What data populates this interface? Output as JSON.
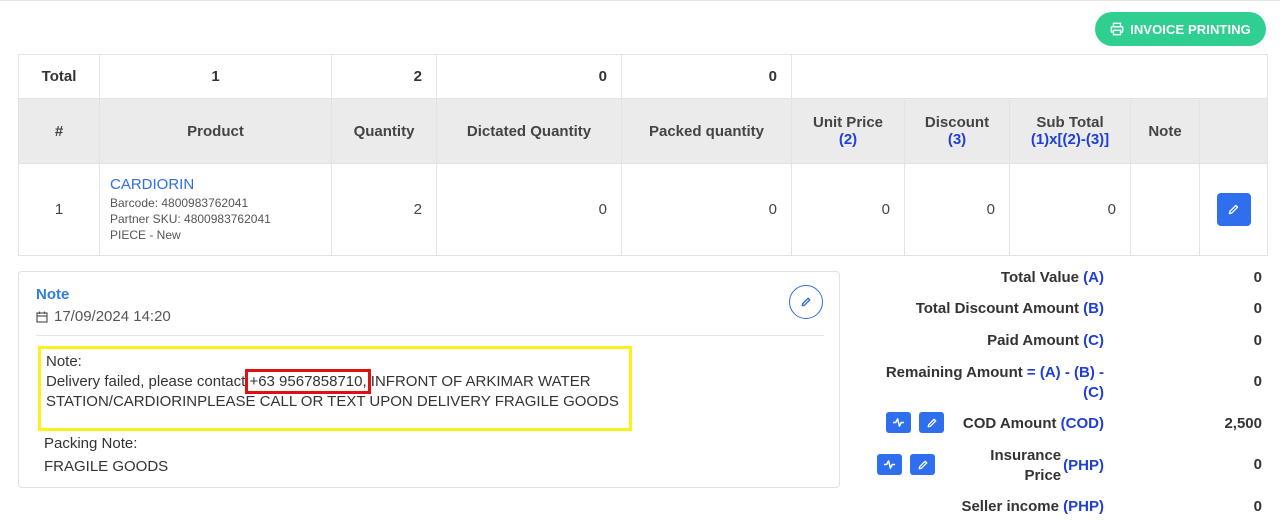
{
  "toolbar": {
    "print_label": "INVOICE PRINTING",
    "print_icon": "printer-icon"
  },
  "table": {
    "total_row": {
      "label": "Total",
      "product": "1",
      "quantity": "2",
      "dictated": "0",
      "packed": "0"
    },
    "headers": {
      "index": "#",
      "product": "Product",
      "quantity": "Quantity",
      "dictated_quantity": "Dictated Quantity",
      "packed_quantity": "Packed quantity",
      "unit_price": "Unit Price",
      "unit_price_sub": "(2)",
      "discount": "Discount",
      "discount_sub": "(3)",
      "sub_total": "Sub Total",
      "sub_total_sub": "(1)x[(2)-(3)]",
      "note": "Note"
    },
    "rows": [
      {
        "index": "1",
        "product_name": "CARDIORIN",
        "barcode": "Barcode: 4800983762041",
        "partner_sku": "Partner SKU: 4800983762041",
        "unit": "PIECE - New",
        "quantity": "2",
        "dictated": "0",
        "packed": "0",
        "unit_price": "0",
        "discount": "0",
        "sub_total": "0",
        "note": ""
      }
    ]
  },
  "note_card": {
    "title": "Note",
    "date": "17/09/2024 14:20",
    "note_label": "Note:",
    "note_text_prefix": "Delivery failed, please contact ",
    "note_phone": "+63 9567858710,",
    "note_text_suffix": " INFRONT OF ARKIMAR WATER STATION/CARDIORINPLEASE CALL OR TEXT UPON DELIVERY FRAGILE GOODS",
    "packing_label": "Packing Note:",
    "packing_text": "FRAGILE GOODS"
  },
  "summary": {
    "total_value": {
      "label": "Total Value ",
      "code": "(A)",
      "value": "0"
    },
    "total_discount": {
      "label": "Total Discount Amount ",
      "code": "(B)",
      "value": "0"
    },
    "paid_amount": {
      "label": "Paid Amount ",
      "code": "(C)",
      "value": "0"
    },
    "remaining": {
      "label": "Remaining Amount ",
      "code": "= (A) - (B) -",
      "code2": "(C)",
      "value": "0"
    },
    "cod": {
      "label": "COD Amount ",
      "code": "(COD)",
      "value": "2,500"
    },
    "insurance": {
      "label": "Insurance",
      "label2": "Price",
      "code": "(PHP)",
      "value": "0"
    },
    "seller_income": {
      "label": "Seller income ",
      "code": "(PHP)",
      "value": "0"
    }
  },
  "colors": {
    "accent_green": "#2ecf8f",
    "primary_blue": "#2f6fee",
    "link_blue": "#2f6fde",
    "highlight_yellow": "#ffef1a",
    "highlight_red": "#e01010"
  }
}
